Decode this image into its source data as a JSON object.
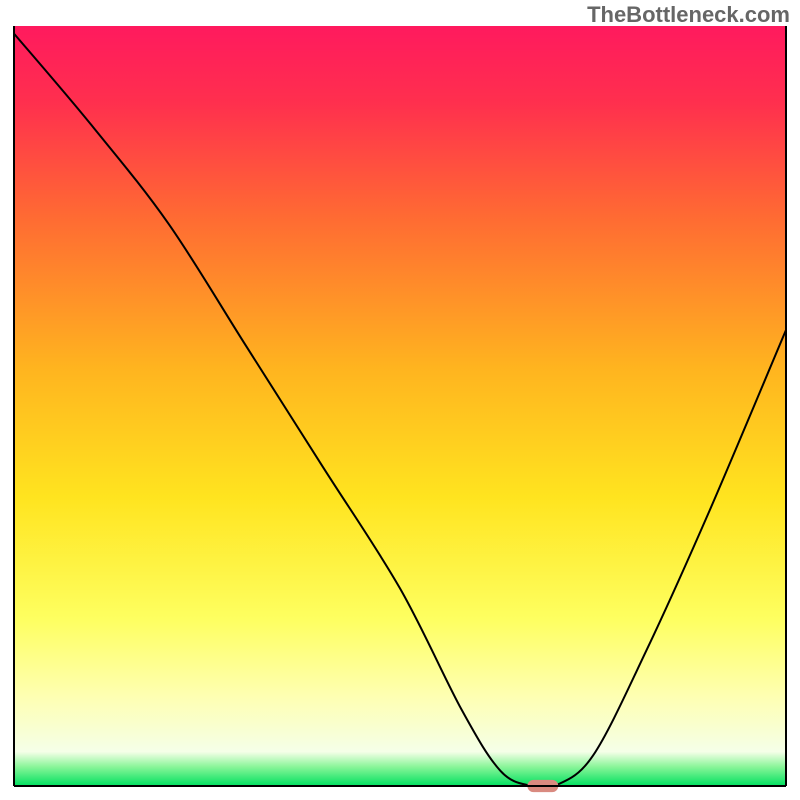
{
  "watermark": "TheBottleneck.com",
  "chart_data": {
    "type": "line",
    "title": "",
    "xlabel": "",
    "ylabel": "",
    "xlim": [
      0,
      100
    ],
    "ylim": [
      0,
      100
    ],
    "grid": false,
    "legend": false,
    "background": {
      "type": "vertical-gradient",
      "description": "magenta/red at top through orange, yellow, pale-yellow, with thin green band at bottom",
      "stops": [
        {
          "offset": 0.0,
          "color": "#ff1a5e"
        },
        {
          "offset": 0.1,
          "color": "#ff2f4e"
        },
        {
          "offset": 0.25,
          "color": "#ff6a33"
        },
        {
          "offset": 0.45,
          "color": "#ffb41f"
        },
        {
          "offset": 0.62,
          "color": "#ffe41f"
        },
        {
          "offset": 0.78,
          "color": "#feff60"
        },
        {
          "offset": 0.88,
          "color": "#feffb0"
        },
        {
          "offset": 0.955,
          "color": "#f5ffe8"
        },
        {
          "offset": 0.975,
          "color": "#88f598"
        },
        {
          "offset": 1.0,
          "color": "#00e060"
        }
      ]
    },
    "series": [
      {
        "name": "bottleneck-curve",
        "color": "#000000",
        "stroke_width": 2,
        "x": [
          0,
          10,
          20,
          30,
          40,
          50,
          58,
          63,
          67,
          70,
          75,
          82,
          90,
          100
        ],
        "values": [
          99,
          87,
          74,
          58,
          42,
          26,
          10,
          2,
          0,
          0,
          4,
          18,
          36,
          60
        ]
      }
    ],
    "marker": {
      "name": "optimum-pill",
      "x": 68.5,
      "y": 0,
      "color": "#d98a80",
      "shape": "rounded-rect",
      "width_pct": 4.0,
      "height_pct": 1.6
    },
    "frame": {
      "color": "#000000",
      "left": true,
      "right": true,
      "bottom": true,
      "top": false
    }
  }
}
